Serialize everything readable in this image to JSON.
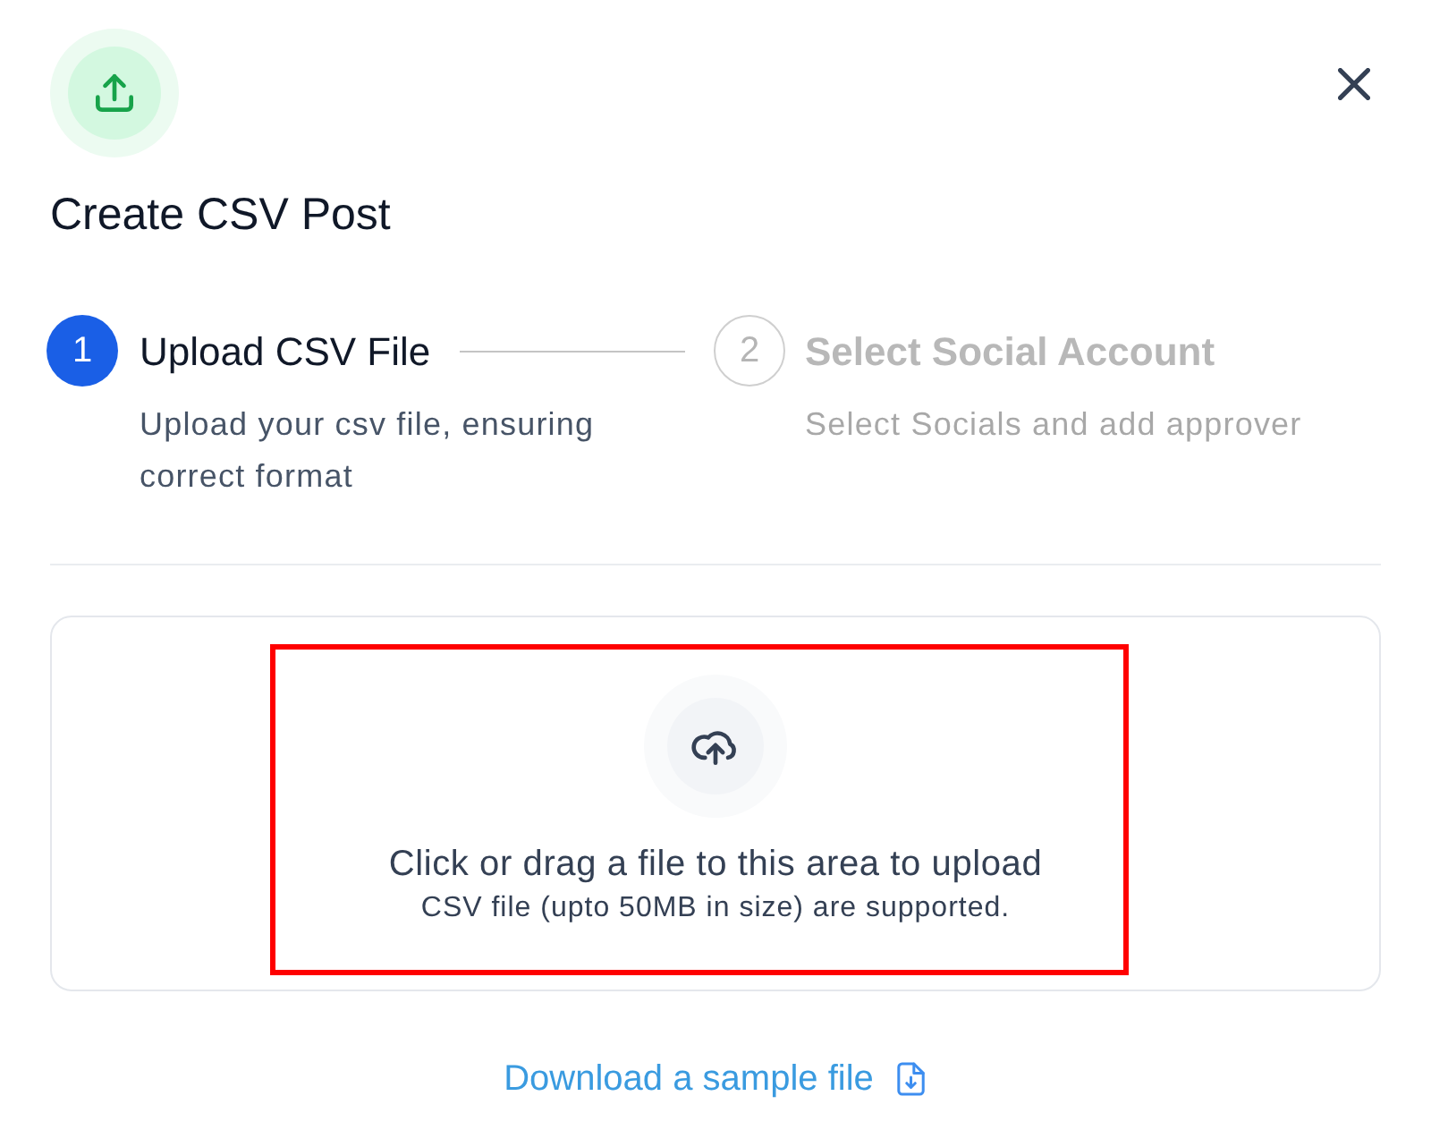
{
  "header": {
    "title": "Create CSV Post"
  },
  "steps": [
    {
      "number": "1",
      "title": "Upload CSV File",
      "description": "Upload your csv file, ensuring correct format",
      "selected": true
    },
    {
      "number": "2",
      "title": "Select Social Account",
      "description": "Select Socials and add approver",
      "selected": false
    }
  ],
  "dropzone": {
    "title": "Click or drag a file to this area to upload",
    "hint": "CSV file (upto 50MB in size) are supported.",
    "highlighted": true
  },
  "sample_link": {
    "label": "Download a sample file"
  }
}
